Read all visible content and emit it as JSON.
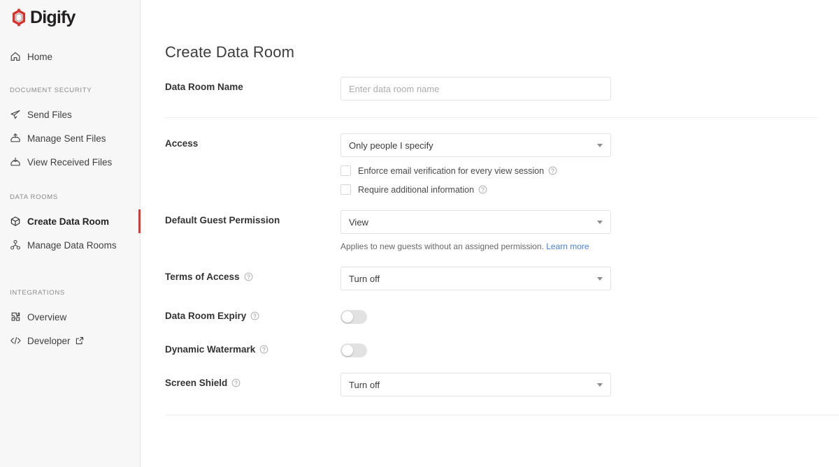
{
  "brand": {
    "name": "Digify",
    "accent_color": "#d93a34"
  },
  "sidebar": {
    "home": {
      "label": "Home",
      "icon": "home-icon"
    },
    "sections": [
      {
        "title": "DOCUMENT SECURITY",
        "items": [
          {
            "label": "Send Files",
            "icon": "send-plane-icon",
            "active": false
          },
          {
            "label": "Manage Sent Files",
            "icon": "upload-tray-icon",
            "active": false
          },
          {
            "label": "View Received Files",
            "icon": "download-tray-icon",
            "active": false
          }
        ]
      },
      {
        "title": "DATA ROOMS",
        "items": [
          {
            "label": "Create Data Room",
            "icon": "cube-icon",
            "active": true
          },
          {
            "label": "Manage Data Rooms",
            "icon": "network-nodes-icon",
            "active": false
          }
        ]
      },
      {
        "title": "INTEGRATIONS",
        "items": [
          {
            "label": "Overview",
            "icon": "puzzle-piece-icon",
            "active": false
          },
          {
            "label": "Developer",
            "icon": "code-brackets-icon",
            "active": false,
            "external": true
          }
        ]
      }
    ]
  },
  "main": {
    "title": "Create Data Room",
    "fields": {
      "data_room_name": {
        "label": "Data Room Name",
        "value": "",
        "placeholder": "Enter data room name"
      },
      "access": {
        "label": "Access",
        "value": "Only people I specify",
        "checkboxes": [
          {
            "label": "Enforce email verification for every view session",
            "checked": false
          },
          {
            "label": "Require additional information",
            "checked": false
          }
        ]
      },
      "default_guest_permission": {
        "label": "Default Guest Permission",
        "value": "View",
        "hint_text": "Applies to new guests without an assigned permission.",
        "hint_link": "Learn more"
      },
      "terms_of_access": {
        "label": "Terms of Access",
        "value": "Turn off"
      },
      "data_room_expiry": {
        "label": "Data Room Expiry",
        "enabled": false
      },
      "dynamic_watermark": {
        "label": "Dynamic Watermark",
        "enabled": false
      },
      "screen_shield": {
        "label": "Screen Shield",
        "value": "Turn off"
      }
    }
  }
}
